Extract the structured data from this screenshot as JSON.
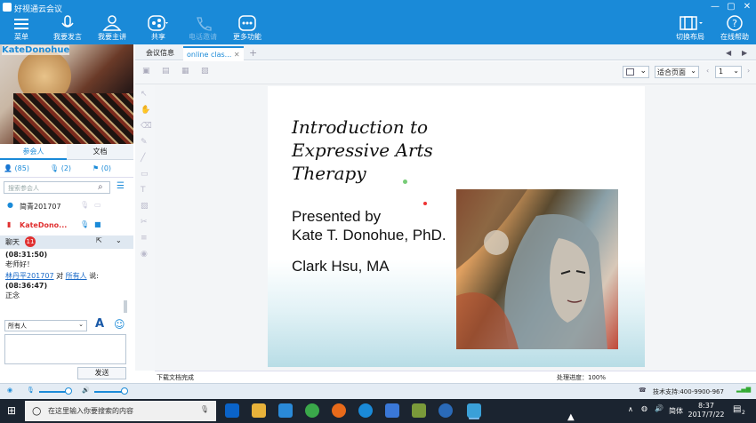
{
  "window": {
    "title": "好视通云会议"
  },
  "toolbar": {
    "menu": "菜单",
    "speak": "我要发言",
    "host": "我要主讲",
    "share": "共享",
    "invite": "电话邀请",
    "more": "更多功能",
    "layout": "切换布局",
    "help": "在线帮助"
  },
  "video": {
    "name": "KateDonohue"
  },
  "left_tabs": {
    "participants": "参会人",
    "docs": "文档"
  },
  "counts": {
    "people": "(85)",
    "speakers": "(2)",
    "hands": "(0)"
  },
  "search": {
    "placeholder": "搜索参会人"
  },
  "participants": [
    {
      "name": "简青201707"
    },
    {
      "name": "KateDono..."
    }
  ],
  "chat": {
    "title": "聊天",
    "badge": "11",
    "messages": [
      {
        "time": "(08:31:50)",
        "text": "老师好！"
      },
      {
        "sender": "林丹平201707",
        "to_word": "对",
        "target": "所有人",
        "said": "说:",
        "time": "(08:36:47)",
        "text": "正念"
      }
    ],
    "recipient": "所有人",
    "send": "发送"
  },
  "doc_tabs": {
    "tab1": "会议信息",
    "tab2": "online clas..."
  },
  "doc_toolbar": {
    "fit": "适合页面",
    "page": "1"
  },
  "slide": {
    "title_lines": [
      "Introduction to",
      "Expressive Arts",
      "Therapy"
    ],
    "presented": [
      "Presented by",
      "Kate T. Donohue, PhD."
    ],
    "coauthor": "Clark Hsu, MA"
  },
  "status": {
    "left": "下载文档完成",
    "right": "处理进度：100%"
  },
  "bottom": {
    "support": "技术支持:400-9900-967"
  },
  "taskbar": {
    "search_placeholder": "在这里输入你要搜索的内容",
    "ime": "简体",
    "time": "8:37",
    "date": "2017/7/22",
    "notif": "2"
  },
  "colors": {
    "brand": "#1a8ad8",
    "alert": "#e03030"
  }
}
